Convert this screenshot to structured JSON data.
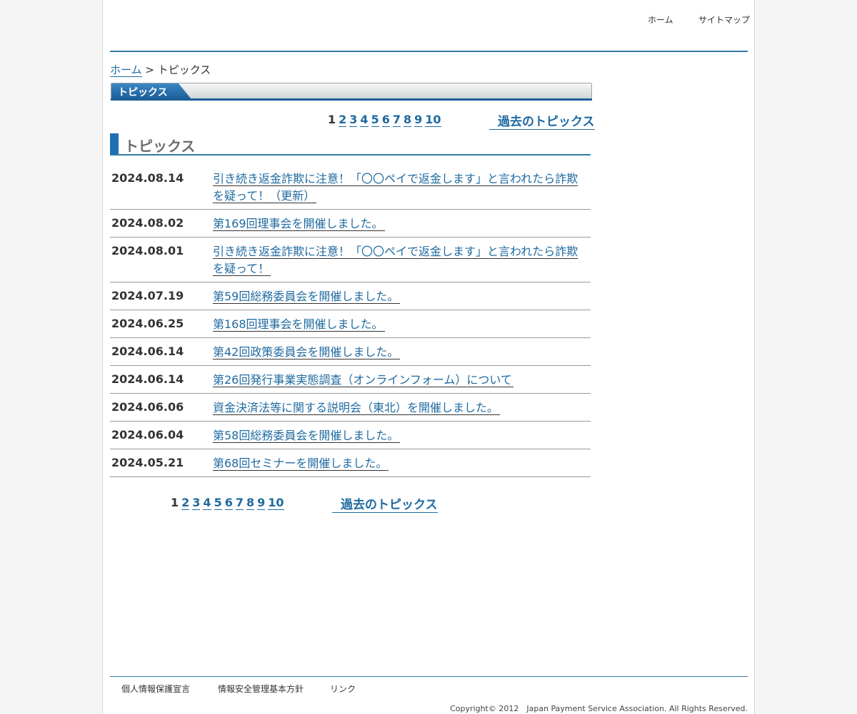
{
  "header": {
    "nav": [
      {
        "label": "ホーム"
      },
      {
        "label": "サイトマップ"
      }
    ]
  },
  "breadcrumb": {
    "home": "ホーム",
    "separator": ">",
    "current": "トピックス"
  },
  "banner": {
    "label": "トピックス"
  },
  "pagination": {
    "current": "1",
    "pages": [
      "2",
      "3",
      "4",
      "5",
      "6",
      "7",
      "8",
      "9",
      "10"
    ],
    "past_label": "過去のトピックス"
  },
  "section": {
    "title": "トピックス"
  },
  "topics": [
    {
      "date": "2024.08.14",
      "title": "引き続き返金詐欺に注意！「〇〇ペイで返金します」と言われたら詐欺を疑って！（更新）"
    },
    {
      "date": "2024.08.02",
      "title": "第169回理事会を開催しました。"
    },
    {
      "date": "2024.08.01",
      "title": "引き続き返金詐欺に注意！「〇〇ペイで返金します」と言われたら詐欺を疑って！"
    },
    {
      "date": "2024.07.19",
      "title": "第59回総務委員会を開催しました。"
    },
    {
      "date": "2024.06.25",
      "title": "第168回理事会を開催しました。"
    },
    {
      "date": "2024.06.14",
      "title": "第42回政策委員会を開催しました。"
    },
    {
      "date": "2024.06.14",
      "title": "第26回発行事業実態調査（オンラインフォーム）について"
    },
    {
      "date": "2024.06.06",
      "title": "資金決済法等に関する説明会（東北）を開催しました。"
    },
    {
      "date": "2024.06.04",
      "title": "第58回総務委員会を開催しました。"
    },
    {
      "date": "2024.05.21",
      "title": "第68回セミナーを開催しました。"
    }
  ],
  "footer": {
    "links": [
      {
        "label": "個人情報保護宣言"
      },
      {
        "label": "情報安全管理基本方針"
      },
      {
        "label": "リンク"
      }
    ],
    "copyright": "Copyright© 2012　Japan Payment Service Association. All Rights Reserved."
  },
  "colors": {
    "accent": "#1f6aa0",
    "rule": "#2f7aa6",
    "section_bar": "#1d6fb4",
    "page_bg": "#f5f5f5"
  }
}
